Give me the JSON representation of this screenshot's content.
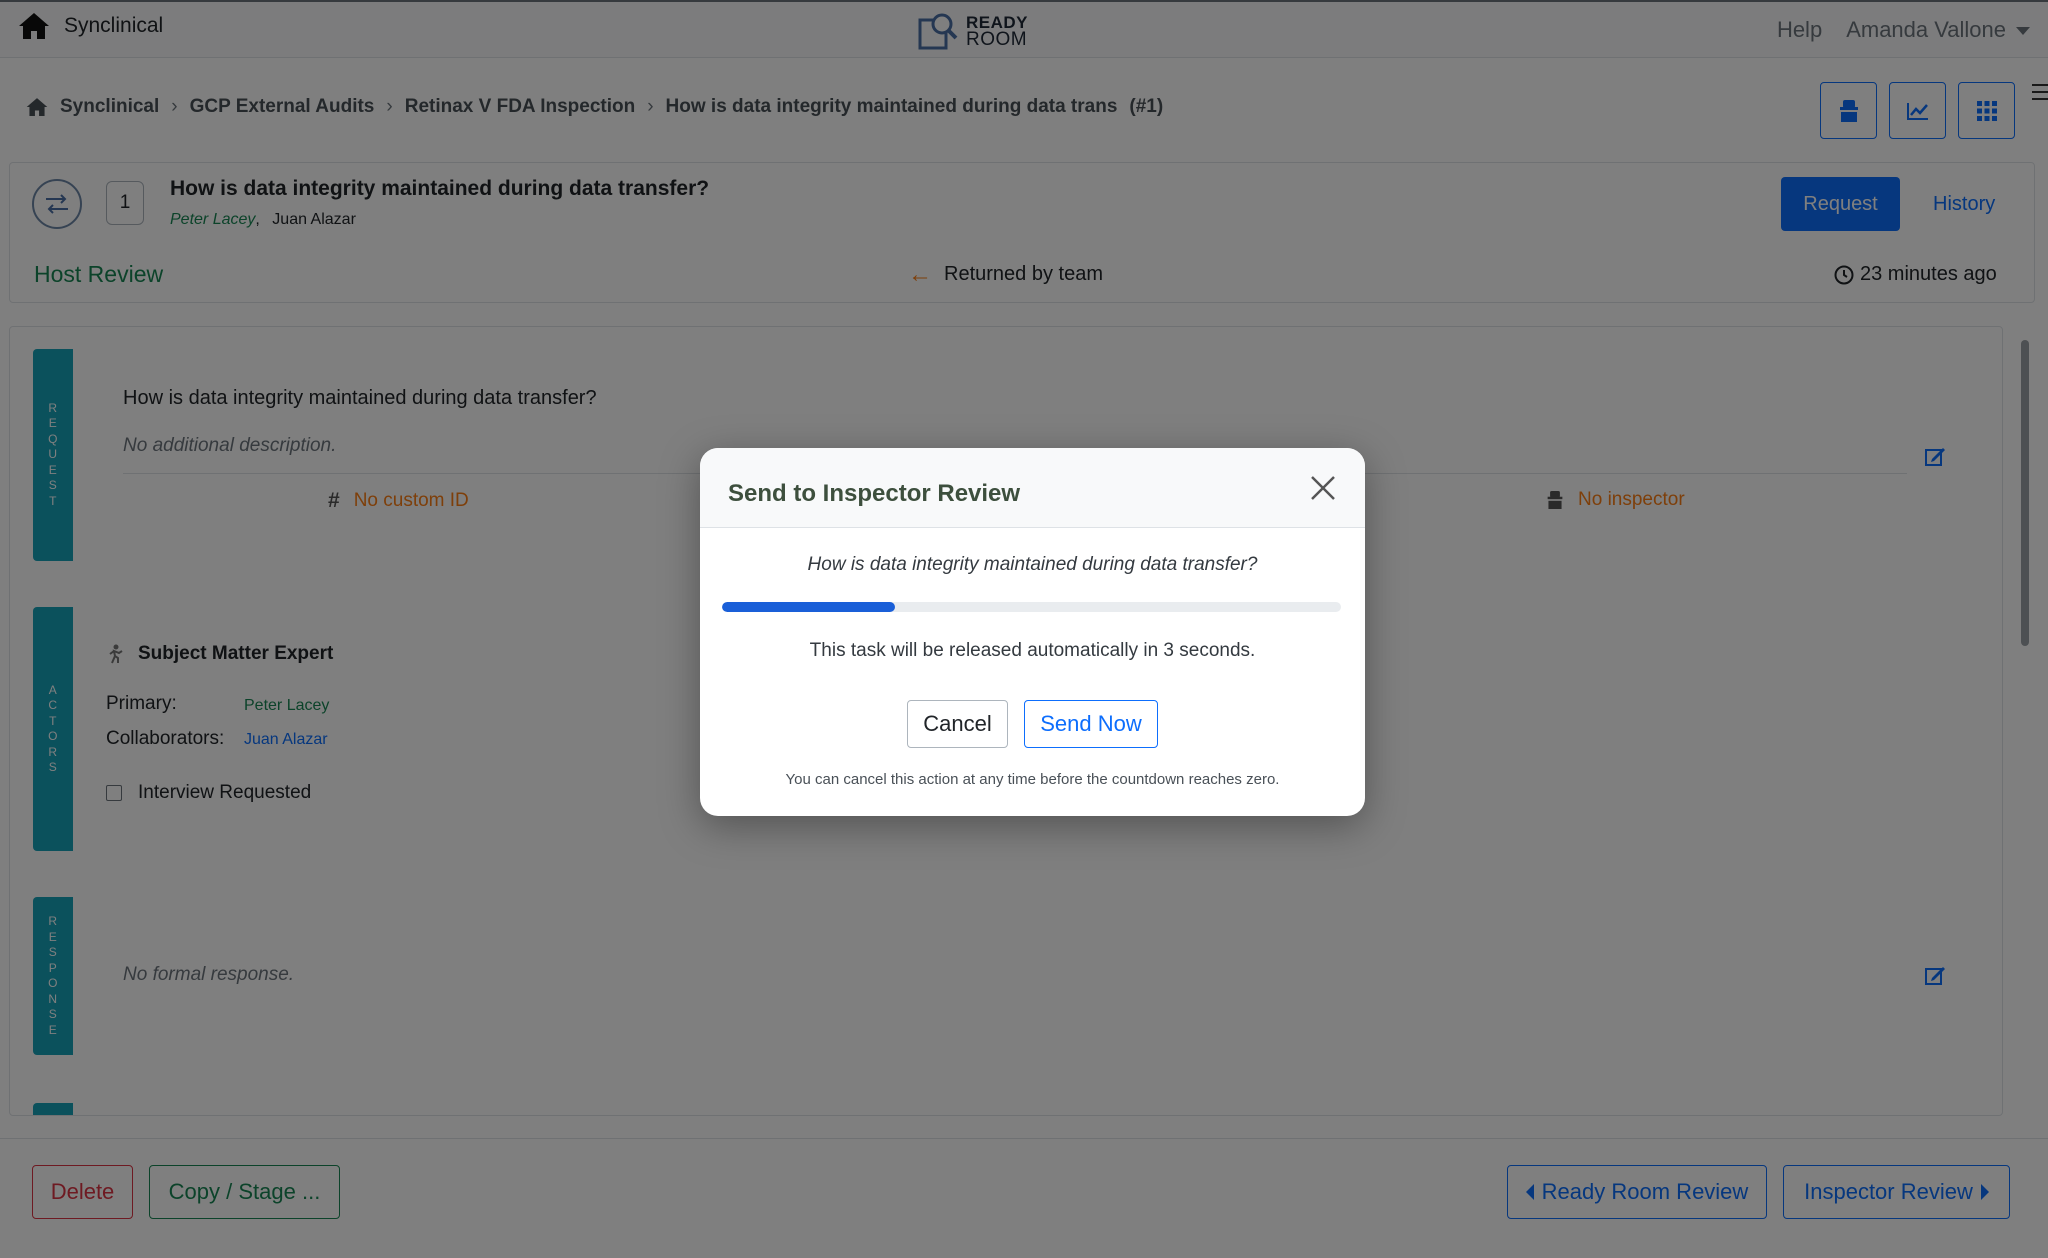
{
  "nav": {
    "brand": "Synclinical",
    "logo_line1": "READY",
    "logo_line2": "ROOM",
    "help": "Help",
    "user": "Amanda Vallone"
  },
  "breadcrumb": {
    "items": [
      "Synclinical",
      "GCP External Audits",
      "Retinax V FDA Inspection",
      "How is data integrity maintained during data trans",
      "(#1)"
    ]
  },
  "task": {
    "number": "1",
    "title": "How is data integrity maintained during data transfer?",
    "primary": "Peter Lacey",
    "separator": ",",
    "collaborator": "Juan Alazar",
    "request_button": "Request",
    "history_link": "History",
    "stage": "Host Review",
    "status": "Returned by team",
    "time_ago": "23 minutes ago"
  },
  "request_section": {
    "tab_label": "REQUEST",
    "question": "How is data integrity maintained during data transfer?",
    "description": "No additional description.",
    "custom_id": "No custom ID",
    "inspector": "No inspector"
  },
  "actors_section": {
    "tab_label": "ACTORS",
    "title": "Subject Matter Expert",
    "primary_label": "Primary:",
    "primary_value": "Peter Lacey",
    "collab_label": "Collaborators:",
    "collab_value": "Juan Alazar",
    "interview_label": "Interview Requested"
  },
  "response_section": {
    "tab_label": "RESPONSE",
    "text": "No formal response."
  },
  "footer": {
    "delete": "Delete",
    "copy_stage": "Copy / Stage ...",
    "ready_room_review": "Ready Room Review",
    "inspector_review": "Inspector Review"
  },
  "modal": {
    "title": "Send to Inspector Review",
    "question": "How is data integrity maintained during data transfer?",
    "progress": 0.28,
    "message": "This task will be released automatically in 3 seconds.",
    "cancel": "Cancel",
    "send_now": "Send Now",
    "note": "You can cancel this action at any time before the countdown reaches zero."
  },
  "colors": {
    "primary": "#0d6efd",
    "success": "#198754",
    "danger": "#dc3545",
    "warning": "#fd7e14",
    "tab": "#17a2b8",
    "progress": "#1a5fd8"
  }
}
